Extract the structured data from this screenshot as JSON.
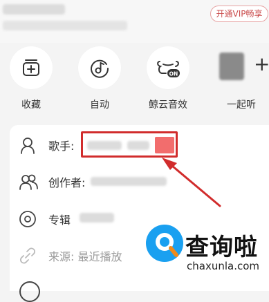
{
  "header": {
    "vip_button": "开通VIP畅享"
  },
  "actions": [
    {
      "label": "收藏",
      "icon": "collect-icon"
    },
    {
      "label": "自动",
      "icon": "auto-icon"
    },
    {
      "label": "鲸云音效",
      "icon": "whale-sound-icon"
    },
    {
      "label": "一起听",
      "icon": "listen-together-icon"
    }
  ],
  "list": {
    "singer_label": "歌手:",
    "creator_label": "创作者:",
    "album_label": "专辑",
    "source_label": "来源: 最近播放"
  },
  "watermark": {
    "title": "查询啦",
    "domain": "chaxunla.com"
  },
  "colors": {
    "highlight": "#d12c2c",
    "vip": "#c94a4a",
    "watermark_blue": "#1aa0f0"
  }
}
